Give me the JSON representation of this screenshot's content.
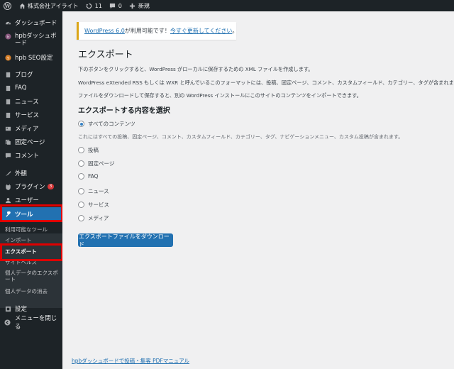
{
  "adminbar": {
    "wp_logo": "W",
    "site_name": "株式会社アイライト",
    "updates_count": "11",
    "comments_count": "0",
    "new_label": "新規"
  },
  "sidebar": {
    "items": [
      {
        "label": "ダッシュボード",
        "icon": "dashboard-icon"
      },
      {
        "label": "hpbダッシュボード",
        "icon": "hpb-icon"
      },
      {
        "label": "hpb SEO設定",
        "icon": "hpb-seo-icon"
      },
      {
        "label": "ブログ",
        "icon": "pin-icon"
      },
      {
        "label": "FAQ",
        "icon": "pin-icon"
      },
      {
        "label": "ニュース",
        "icon": "pin-icon"
      },
      {
        "label": "サービス",
        "icon": "pin-icon"
      },
      {
        "label": "メディア",
        "icon": "media-icon"
      },
      {
        "label": "固定ページ",
        "icon": "page-icon"
      },
      {
        "label": "コメント",
        "icon": "comment-icon"
      },
      {
        "label": "外観",
        "icon": "appearance-icon"
      },
      {
        "label": "プラグイン",
        "icon": "plugin-icon",
        "badge": "3"
      },
      {
        "label": "ユーザー",
        "icon": "user-icon"
      },
      {
        "label": "ツール",
        "icon": "tools-icon"
      },
      {
        "label": "設定",
        "icon": "settings-icon"
      },
      {
        "label": "メニューを閉じる",
        "icon": "collapse-icon"
      }
    ],
    "tools_submenu": [
      "利用可能なツール",
      "インポート",
      "エクスポート",
      "サイトヘルス",
      "個人データのエクスポート",
      "個人データの消去"
    ]
  },
  "notice": {
    "link_version": "WordPress 6.0",
    "text": " が利用可能です！",
    "link_update": "今すぐ更新してください",
    "suffix": "。"
  },
  "page": {
    "title": "エクスポート",
    "paragraphs": [
      "下のボタンをクリックすると、WordPress がローカルに保存するための XML ファイルを作成します。",
      "WordPress eXtended RSS もしくは WXR と呼んでいるこのフォーマットには、投稿、固定ページ、コメント、カスタムフィールド、カテゴリー、タグが含まれます。",
      "ファイルをダウンロードして保存すると、別の WordPress インストールにこのサイトのコンテンツをインポートできます。"
    ],
    "section_heading": "エクスポートする内容を選択",
    "options": [
      {
        "label": "すべてのコンテンツ",
        "checked": true
      },
      {
        "label": "投稿",
        "checked": false
      },
      {
        "label": "固定ページ",
        "checked": false
      },
      {
        "label": "FAQ",
        "checked": false
      },
      {
        "label": "ニュース",
        "checked": false
      },
      {
        "label": "サービス",
        "checked": false
      },
      {
        "label": "メディア",
        "checked": false
      }
    ],
    "all_content_desc": "これにはすべての投稿、固定ページ、コメント、カスタムフィールド、カテゴリー、タグ、ナビゲーションメニュー、カスタム投稿が含まれます。",
    "download_button": "エクスポートファイルをダウンロード",
    "footer_link": "hpbダッシュボードで投稿・集客 PDFマニュアル"
  },
  "colors": {
    "accent": "#2271b1",
    "admin_dark": "#1d2327",
    "highlight": "#e00000",
    "notice_warning": "#dba617"
  }
}
